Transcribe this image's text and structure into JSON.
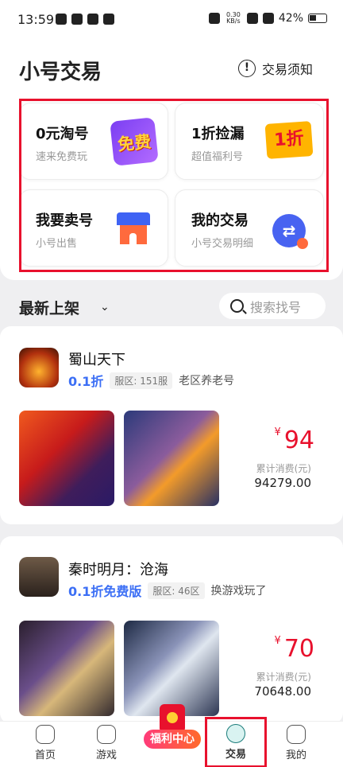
{
  "status_bar": {
    "time": "13:59",
    "net_speed": "0.30\nKB/s",
    "battery": "42%"
  },
  "header": {
    "title": "小号交易",
    "notice_label": "交易须知"
  },
  "quick_cards": [
    {
      "title": "0元淘号",
      "subtitle": "速来免费玩",
      "badge": "免费"
    },
    {
      "title": "1折捡漏",
      "subtitle": "超值福利号",
      "badge": "1折"
    },
    {
      "title": "我要卖号",
      "subtitle": "小号出售"
    },
    {
      "title": "我的交易",
      "subtitle": "小号交易明细"
    }
  ],
  "filter": {
    "title": "最新上架",
    "search_placeholder": "搜索找号"
  },
  "listings": [
    {
      "game": "蜀山天下",
      "discount": "0.1折",
      "server": "服区: 151服",
      "note": "老区养老号",
      "currency": "¥",
      "price": "94",
      "spend_label": "累计消费(元)",
      "spend_value": "94279.00"
    },
    {
      "game": "秦时明月：沧海",
      "discount": "0.1折免费版",
      "server": "服区: 46区",
      "note": "换游戏玩了",
      "currency": "¥",
      "price": "70",
      "spend_label": "累计消费(元)",
      "spend_value": "70648.00"
    }
  ],
  "tabbar": [
    {
      "label": "首页"
    },
    {
      "label": "游戏"
    },
    {
      "label": "福利中心"
    },
    {
      "label": "交易"
    },
    {
      "label": "我的"
    }
  ]
}
